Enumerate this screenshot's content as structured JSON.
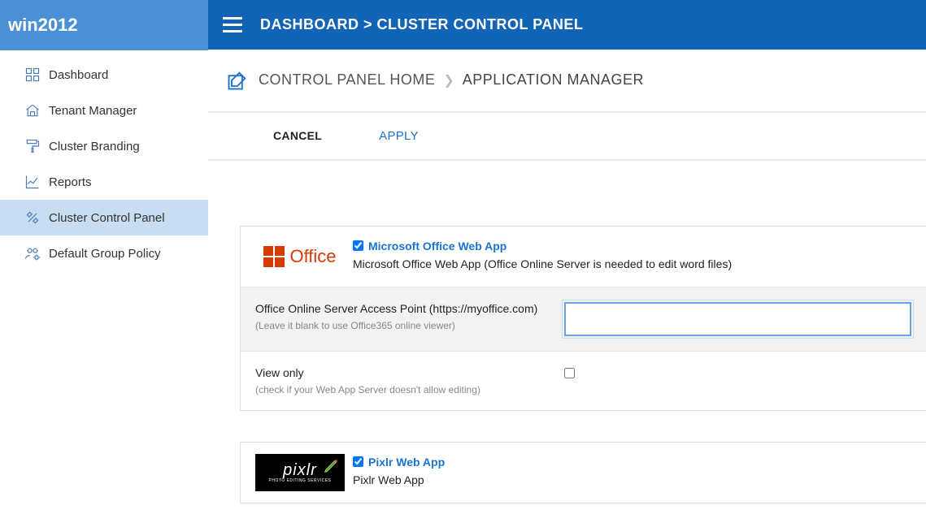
{
  "sidebar": {
    "brand": "win2012",
    "items": [
      {
        "label": "Dashboard"
      },
      {
        "label": "Tenant Manager"
      },
      {
        "label": "Cluster Branding"
      },
      {
        "label": "Reports"
      },
      {
        "label": "Cluster Control Panel"
      },
      {
        "label": "Default Group Policy"
      }
    ]
  },
  "topbar": {
    "dashboard": "DASHBOARD",
    "sep": ">",
    "page": "CLUSTER CONTROL PANEL"
  },
  "breadcrumb": {
    "home": "CONTROL PANEL HOME",
    "current": "APPLICATION MANAGER"
  },
  "actions": {
    "cancel": "CANCEL",
    "apply": "APPLY"
  },
  "apps": {
    "office": {
      "logo_text": "Office",
      "title": "Microsoft Office Web App",
      "checked": true,
      "desc": "Microsoft Office Web App (Office Online Server is needed to edit word files)",
      "access_label": "Office Online Server Access Point (https://myoffice.com)",
      "access_sublabel": "(Leave it blank to use Office365 online viewer)",
      "access_value": "",
      "viewonly_label": "View only",
      "viewonly_sublabel": "(check if your Web App Server doesn't allow editing)",
      "viewonly_checked": false
    },
    "pixlr": {
      "brand": "pixlr",
      "tag": "PHOTO EDITING SERVICES",
      "title": "Pixlr Web App",
      "checked": true,
      "desc": "Pixlr Web App"
    }
  }
}
